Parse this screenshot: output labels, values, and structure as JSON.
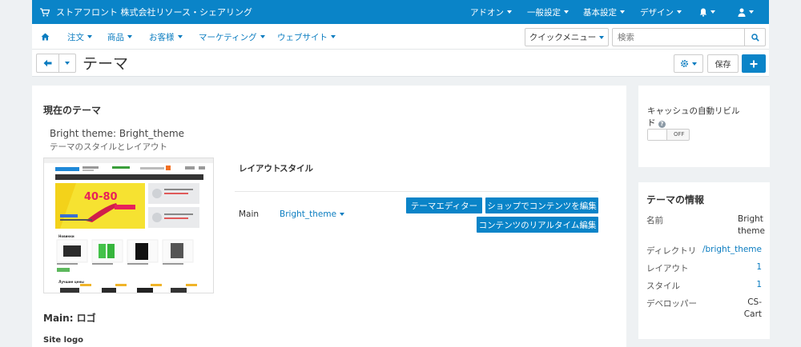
{
  "topbar": {
    "store_name": "ストアフロント 株式会社リソース・シェアリング",
    "menus": [
      "アドオン",
      "一般設定",
      "基本設定",
      "デザイン"
    ]
  },
  "nav": {
    "items": [
      "注文",
      "商品",
      "お客様",
      "マーケティング",
      "ウェブサイト"
    ],
    "quick_menu": "クイックメニュー",
    "search_placeholder": "検索"
  },
  "titlebar": {
    "title": "テーマ",
    "save_label": "保存"
  },
  "current_theme": {
    "heading": "現在のテーマ",
    "name": "Bright theme: Bright_theme",
    "subtitle": "テーマのスタイルとレイアウト",
    "table_headers": {
      "layout": "レイアウト",
      "style": "スタイル"
    },
    "row": {
      "layout": "Main",
      "style": "Bright_theme"
    },
    "buttons": {
      "theme_editor": "テーマエディター",
      "edit_content": "ショップでコンテンツを編集",
      "live_edit": "コンテンツのリアルタイム編集"
    },
    "preview": {
      "promo": "40-80",
      "section_new": "Новинки",
      "section_popular": "Лучшие цены"
    }
  },
  "logo_section": {
    "heading": "Main: ロゴ",
    "label": "Site logo"
  },
  "cache_panel": {
    "label": "キャッシュの自動リビルド",
    "help_icon": "?",
    "toggle_state": "OFF"
  },
  "theme_info": {
    "heading": "テーマの情報",
    "rows": [
      {
        "label": "名前",
        "value": "Bright theme",
        "link": false
      },
      {
        "label": "ディレクトリ",
        "value": "/bright_theme",
        "link": true
      },
      {
        "label": "レイアウト",
        "value": "1",
        "link": true
      },
      {
        "label": "スタイル",
        "value": "1",
        "link": true
      },
      {
        "label": "デベロッパー",
        "value": "CS-Cart",
        "link": false
      }
    ]
  },
  "colors": {
    "accent": "#0a84c8",
    "link": "#0a7cc0",
    "background": "#eef1f3"
  },
  "icons": [
    "cart-icon",
    "bell-icon",
    "user-icon",
    "home-icon",
    "search-icon",
    "arrow-left-icon",
    "gear-icon",
    "plus-icon",
    "question-icon"
  ]
}
